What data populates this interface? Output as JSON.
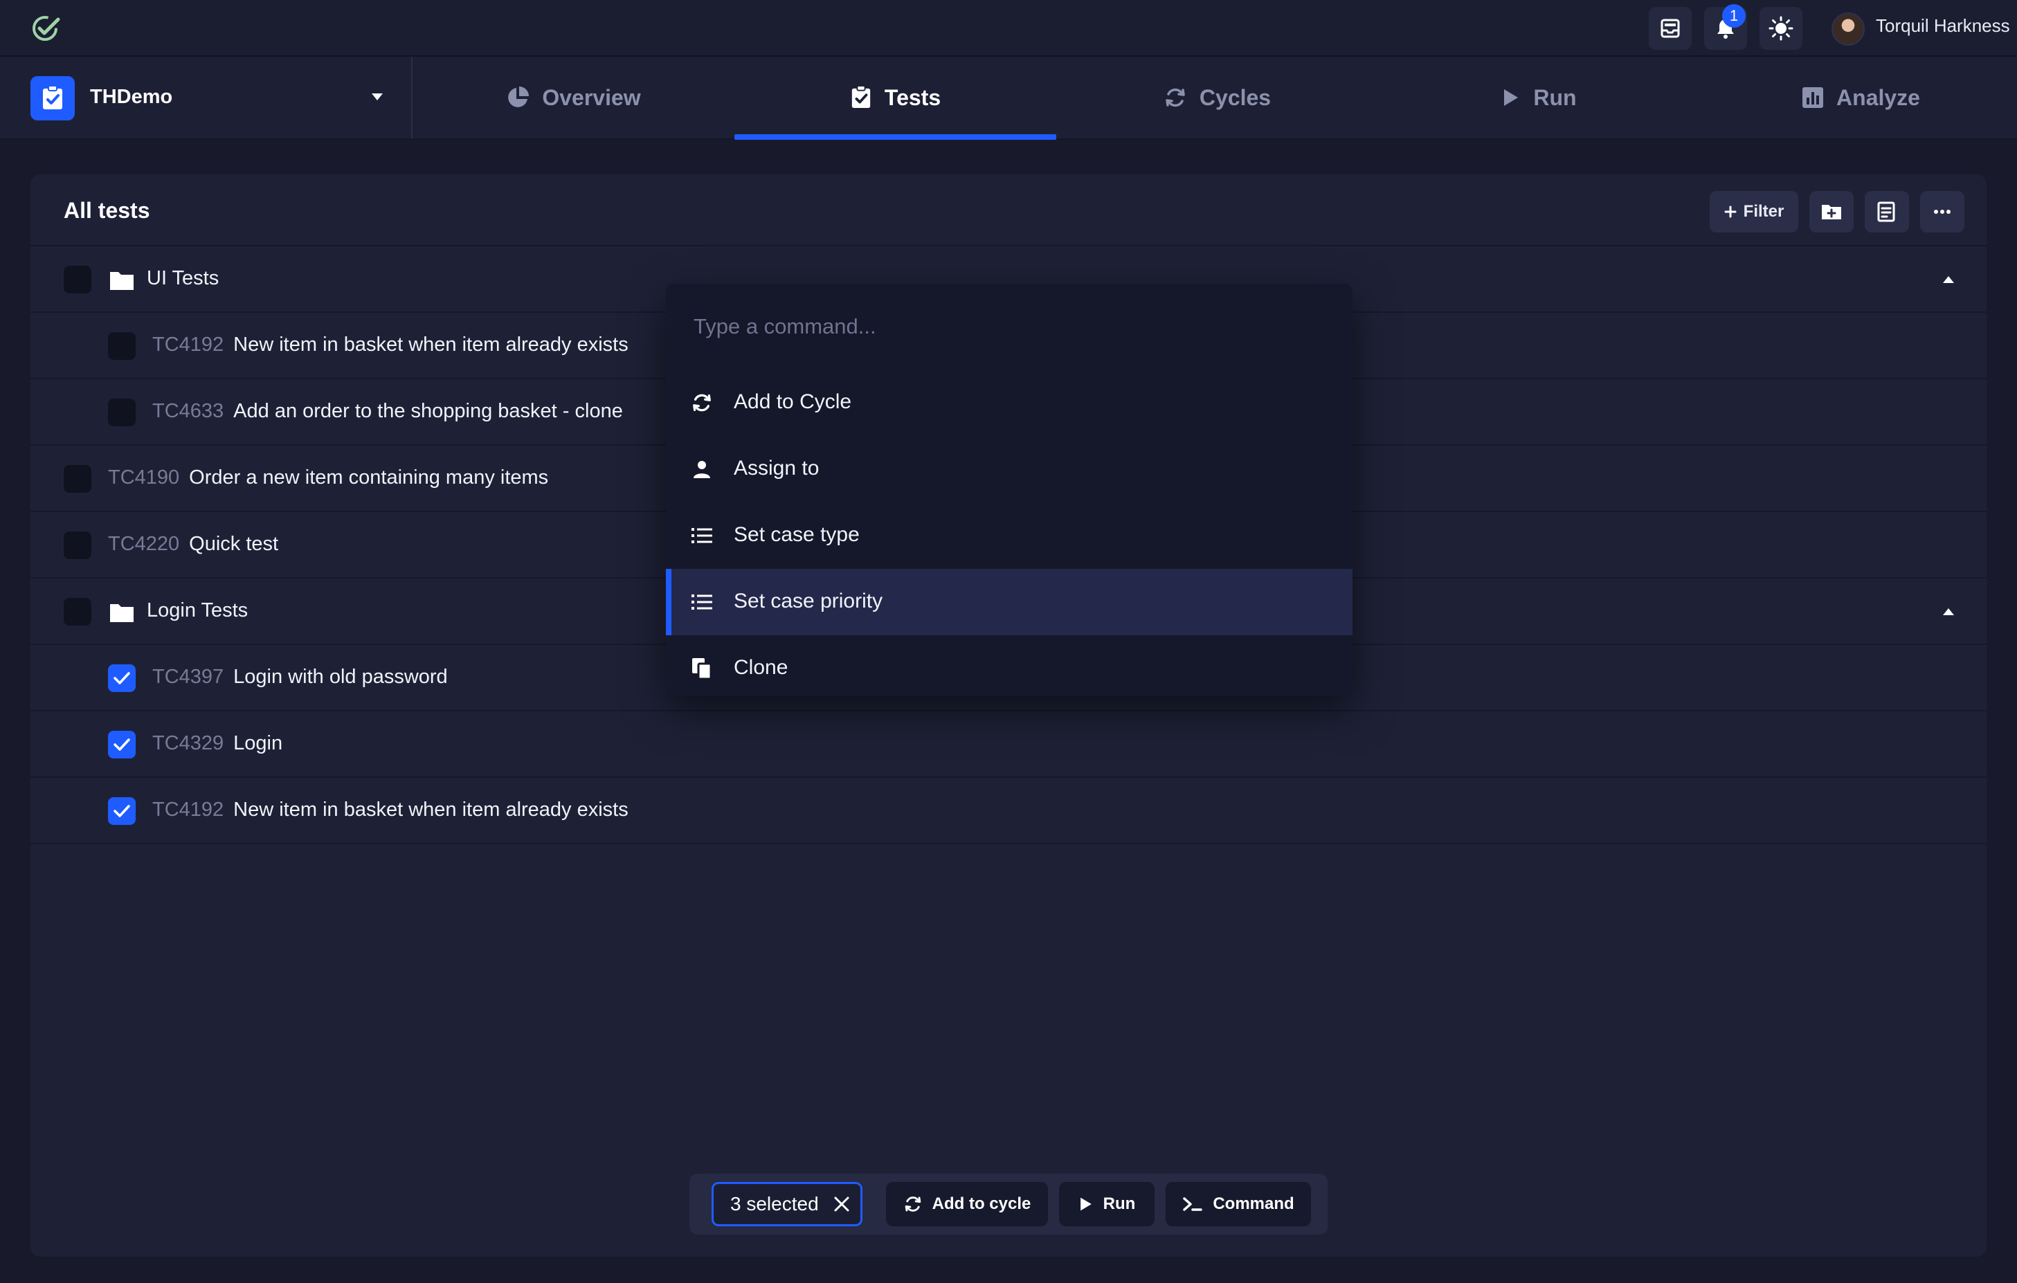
{
  "topbar": {
    "notification_count": "1",
    "user_name": "Torquil Harkness"
  },
  "project": {
    "name": "THDemo"
  },
  "tabs": [
    {
      "label": "Overview",
      "icon": "pie-chart-icon"
    },
    {
      "label": "Tests",
      "icon": "clipboard-check-icon",
      "active": true
    },
    {
      "label": "Cycles",
      "icon": "cycle-icon"
    },
    {
      "label": "Run",
      "icon": "play-icon"
    },
    {
      "label": "Analyze",
      "icon": "bar-chart-icon"
    }
  ],
  "panel": {
    "title": "All tests",
    "filter_label": "Filter"
  },
  "rows": [
    {
      "type": "folder",
      "name": "UI Tests",
      "checked": false
    },
    {
      "type": "case",
      "id": "TC4192",
      "name": "New item in basket when item already exists",
      "checked": false,
      "indent": 1
    },
    {
      "type": "case",
      "id": "TC4633",
      "name": "Add an order to the shopping basket - clone",
      "checked": false,
      "indent": 1
    },
    {
      "type": "case",
      "id": "TC4190",
      "name": "Order a new item containing many items",
      "checked": false,
      "indent": 0
    },
    {
      "type": "case",
      "id": "TC4220",
      "name": "Quick test",
      "checked": false,
      "indent": 0
    },
    {
      "type": "folder",
      "name": "Login Tests",
      "checked": false
    },
    {
      "type": "case",
      "id": "TC4397",
      "name": "Login with old password",
      "checked": true,
      "indent": 1
    },
    {
      "type": "case",
      "id": "TC4329",
      "name": "Login",
      "checked": true,
      "indent": 1
    },
    {
      "type": "case",
      "id": "TC4192",
      "name": "New item in basket when item already exists",
      "checked": true,
      "indent": 1
    }
  ],
  "command_palette": {
    "placeholder": "Type a command...",
    "items": [
      {
        "label": "Add to Cycle",
        "icon": "cycle-icon"
      },
      {
        "label": "Assign to",
        "icon": "user-icon"
      },
      {
        "label": "Set case type",
        "icon": "list-icon"
      },
      {
        "label": "Set case priority",
        "icon": "list-icon",
        "active": true
      },
      {
        "label": "Clone",
        "icon": "copy-icon"
      }
    ]
  },
  "action_bar": {
    "selected_label": "3 selected",
    "add_to_cycle_label": "Add to cycle",
    "run_label": "Run",
    "command_label": "Command"
  },
  "colors": {
    "accent": "#1f5cff",
    "background": "#181a2b",
    "panel": "#1e2136"
  }
}
